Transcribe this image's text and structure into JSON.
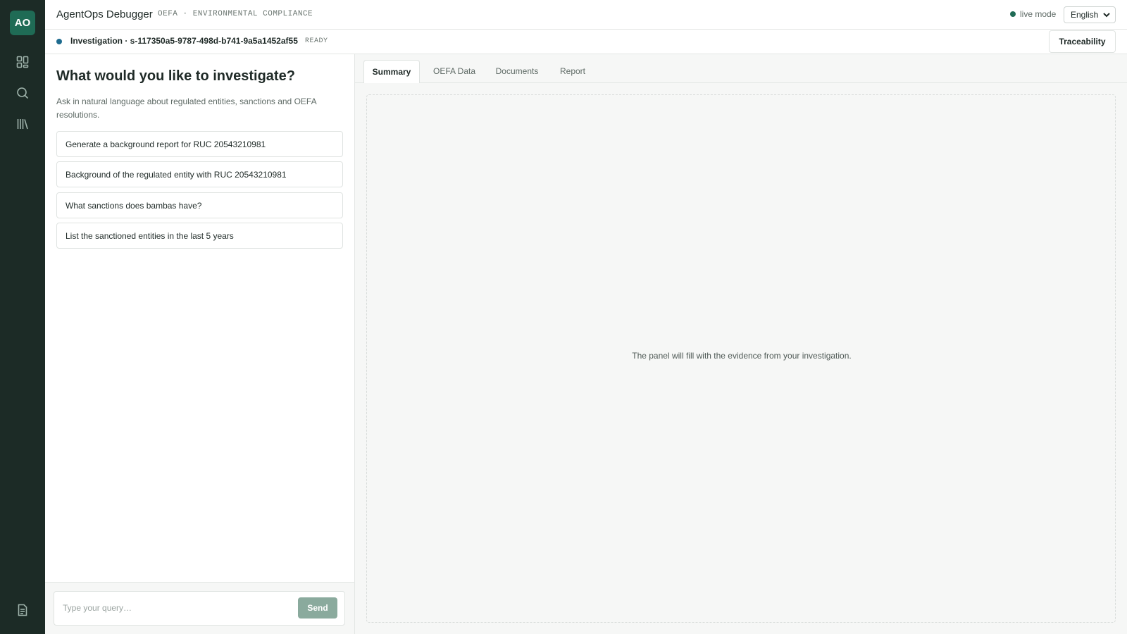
{
  "rail": {
    "logo_text": "AO",
    "items": [
      {
        "name": "dashboard-icon"
      },
      {
        "name": "search-icon"
      },
      {
        "name": "library-icon"
      }
    ],
    "bottom_item": {
      "name": "document-icon"
    }
  },
  "topbar": {
    "title": "AgentOps Debugger",
    "subtitle": "OEFA · ENVIRONMENTAL COMPLIANCE",
    "live_label": "live mode",
    "language": "English"
  },
  "session": {
    "title": "Investigation · s-117350a5-9787-498d-b741-9a5a1452af55",
    "status": "READY",
    "traceability_label": "Traceability"
  },
  "left": {
    "heading": "What would you like to investigate?",
    "description": "Ask in natural language about regulated entities, sanctions and OEFA resolutions.",
    "suggestions": [
      "Generate a background report for RUC 20543210981",
      "Background of the regulated entity with RUC 20543210981",
      "What sanctions does bambas have?",
      "List the sanctioned entities in the last 5 years"
    ],
    "composer": {
      "placeholder": "Type your query…",
      "value": "",
      "send_label": "Send"
    }
  },
  "right": {
    "tabs": [
      "Summary",
      "OEFA Data",
      "Documents",
      "Report"
    ],
    "active_tab": "Summary",
    "empty_message": "The panel will fill with the evidence from your investigation."
  },
  "colors": {
    "rail_bg": "#1c2b26",
    "accent": "#1f6b55",
    "session_dot": "#1e6b8f",
    "send_button": "#8aaa9d"
  }
}
